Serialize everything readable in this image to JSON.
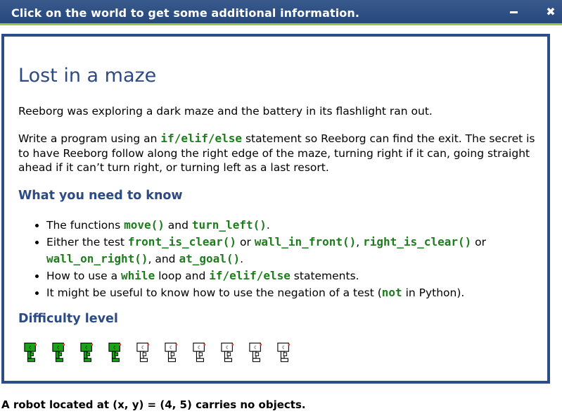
{
  "titlebar": {
    "title": "Click on the world to get some additional information.",
    "minimize_icon": "minimize-icon",
    "close_label": "✖"
  },
  "content": {
    "heading": "Lost in a maze",
    "intro": "Reeborg was exploring a dark maze and the battery in its flashlight ran out.",
    "task": {
      "before": "Write a program using an ",
      "code": "if/elif/else",
      "after": " statement so Reeborg can find the exit. The secret is to have Reeborg follow along the right edge of the maze, turning right if it can, going straight ahead if it can’t turn right, or turning left as a last resort."
    },
    "know_heading": "What you need to know",
    "know_items": [
      {
        "t0": "The functions ",
        "c0": "move()",
        "t1": " and ",
        "c1": "turn_left()",
        "t2": "."
      },
      {
        "t0": "Either the test ",
        "c0": "front_is_clear()",
        "t1": " or ",
        "c1": "wall_in_front()",
        "t2": ", ",
        "c2": "right_is_clear()",
        "t3": " or ",
        "c3": "wall_on_right()",
        "t4": ", and ",
        "c4": "at_goal()",
        "t5": "."
      },
      {
        "t0": "How to use a ",
        "c0": "while",
        "t1": " loop and ",
        "c1": "if/elif/else",
        "t2": " statements."
      },
      {
        "t0": "It might be useful to know how to use the negation of a test (",
        "c0": "not",
        "t1": " in Python)."
      }
    ],
    "difficulty_heading": "Difficulty level",
    "difficulty": {
      "level": 4,
      "max": 10,
      "filled_color": "#1aa31a",
      "empty_color": "#ffffff"
    }
  },
  "status": "A robot located at (x, y) = (4, 5) carries no objects."
}
